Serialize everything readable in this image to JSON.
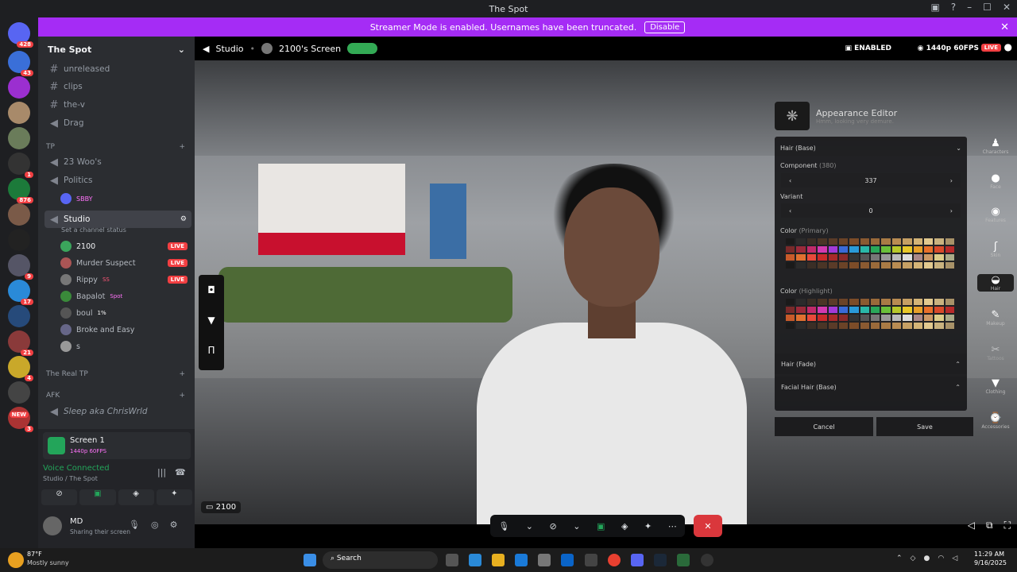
{
  "window": {
    "title": "The Spot"
  },
  "banner": {
    "text": "Streamer Mode is enabled. Usernames have been truncated.",
    "button": "Disable"
  },
  "guild_badges": [
    "428",
    "43",
    "1",
    "876",
    "9",
    "17",
    "21",
    "4",
    "NEW",
    "3"
  ],
  "server": {
    "name": "The Spot"
  },
  "channels": [
    {
      "type": "text",
      "name": "unreleased"
    },
    {
      "type": "text",
      "name": "clips"
    },
    {
      "type": "text",
      "name": "the-v"
    },
    {
      "type": "voice",
      "name": "Drag"
    }
  ],
  "category_tp": "TP",
  "tp_channels": [
    {
      "name": "23 Woo's"
    },
    {
      "name": "Politics"
    }
  ],
  "politics_user": "SBBY",
  "studio": {
    "name": "Studio",
    "status": "Set a channel status"
  },
  "voice_users": [
    {
      "name": "2100",
      "badge": "",
      "live": "LIVE"
    },
    {
      "name": "Murder Suspect",
      "badge": "",
      "live": "LIVE"
    },
    {
      "name": "Rippy",
      "badge": "SS",
      "live": "LIVE"
    },
    {
      "name": "Bapalot",
      "badge": "Spot",
      "live": ""
    },
    {
      "name": "boul",
      "badge": "1%",
      "live": ""
    },
    {
      "name": "Broke and Easy",
      "badge": "",
      "live": ""
    },
    {
      "name": "s",
      "badge": "",
      "live": ""
    }
  ],
  "category_realtp": "The Real TP",
  "category_afk": "AFK",
  "afk_channel": "Sleep aka ChrisWrld",
  "screen": {
    "title": "Screen 1",
    "quality": "1440p 60FPS"
  },
  "voice": {
    "status": "Voice Connected",
    "location": "Studio / The Spot"
  },
  "user": {
    "name": "MD",
    "status": "Sharing their screen"
  },
  "stage": {
    "channel": "Studio",
    "screen": "2100's Screen",
    "enabled": "ENABLED",
    "quality": "1440p 60FPS",
    "live": "LIVE",
    "tile_label": "2100"
  },
  "editor": {
    "title": "Appearance Editor",
    "subtitle": "Hmm, looking very demure.",
    "section": "Hair (Base)",
    "component_label": "Component",
    "component_count": "(380)",
    "component_value": "337",
    "variant_label": "Variant",
    "variant_value": "0",
    "color_primary": "Color",
    "color_primary_sub": "(Primary)",
    "color_highlight": "Color",
    "color_highlight_sub": "(Highlight)",
    "hair_fade": "Hair (Fade)",
    "facial_hair": "Facial Hair (Base)",
    "cancel": "Cancel",
    "save": "Save"
  },
  "rail": [
    "Characters",
    "Face",
    "Features",
    "Skin",
    "Hair",
    "Makeup",
    "Tattoos",
    "Clothing",
    "Accessories"
  ],
  "weather": {
    "temp": "87°F",
    "desc": "Mostly sunny"
  },
  "search_label": "Search",
  "clock": {
    "time": "11:29 AM",
    "date": "9/16/2025"
  },
  "palette_colors": [
    "#1a1a1a",
    "#2b2b2b",
    "#3a2e26",
    "#4a3526",
    "#5a3b28",
    "#6b4327",
    "#7c4c28",
    "#8a5a31",
    "#9a6a3a",
    "#a97b45",
    "#b98c52",
    "#c6a064",
    "#d4b477",
    "#e2c98f",
    "#c9b27f",
    "#a89268"
  ]
}
